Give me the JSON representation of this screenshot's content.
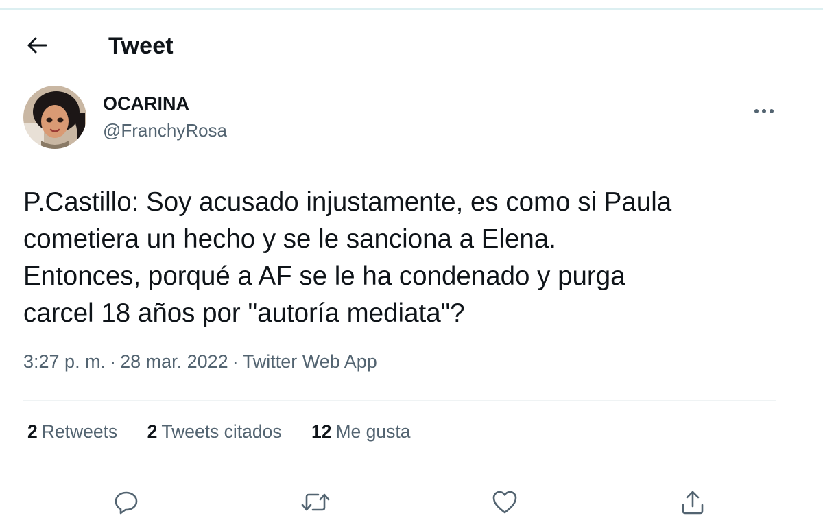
{
  "header": {
    "title": "Tweet",
    "back_icon": "arrow-left-icon"
  },
  "tweet": {
    "author": {
      "display_name": "OCARINA",
      "handle": "@FranchyRosa"
    },
    "more_icon": "more-horizontal-icon",
    "text": "P.Castillo: Soy acusado injustamente, es como si Paula\ncometiera un hecho y se le sanciona a Elena.\nEntonces, porqué a AF se le ha condenado y purga\ncarcel 18 años por \"autoría mediata\"?",
    "time": "3:27 p. m.",
    "date": "28 mar. 2022",
    "separator": "·",
    "source": "Twitter Web App"
  },
  "stats": {
    "retweets": {
      "count": "2",
      "label": "Retweets"
    },
    "quotes": {
      "count": "2",
      "label": "Tweets citados"
    },
    "likes": {
      "count": "12",
      "label": "Me gusta"
    }
  },
  "actions": {
    "reply_icon": "reply-icon",
    "retweet_icon": "retweet-icon",
    "like_icon": "heart-icon",
    "share_icon": "share-icon"
  },
  "colors": {
    "text": "#0f1419",
    "secondary": "#536471",
    "divider": "#eff3f4",
    "top_rule": "#dceff1"
  }
}
